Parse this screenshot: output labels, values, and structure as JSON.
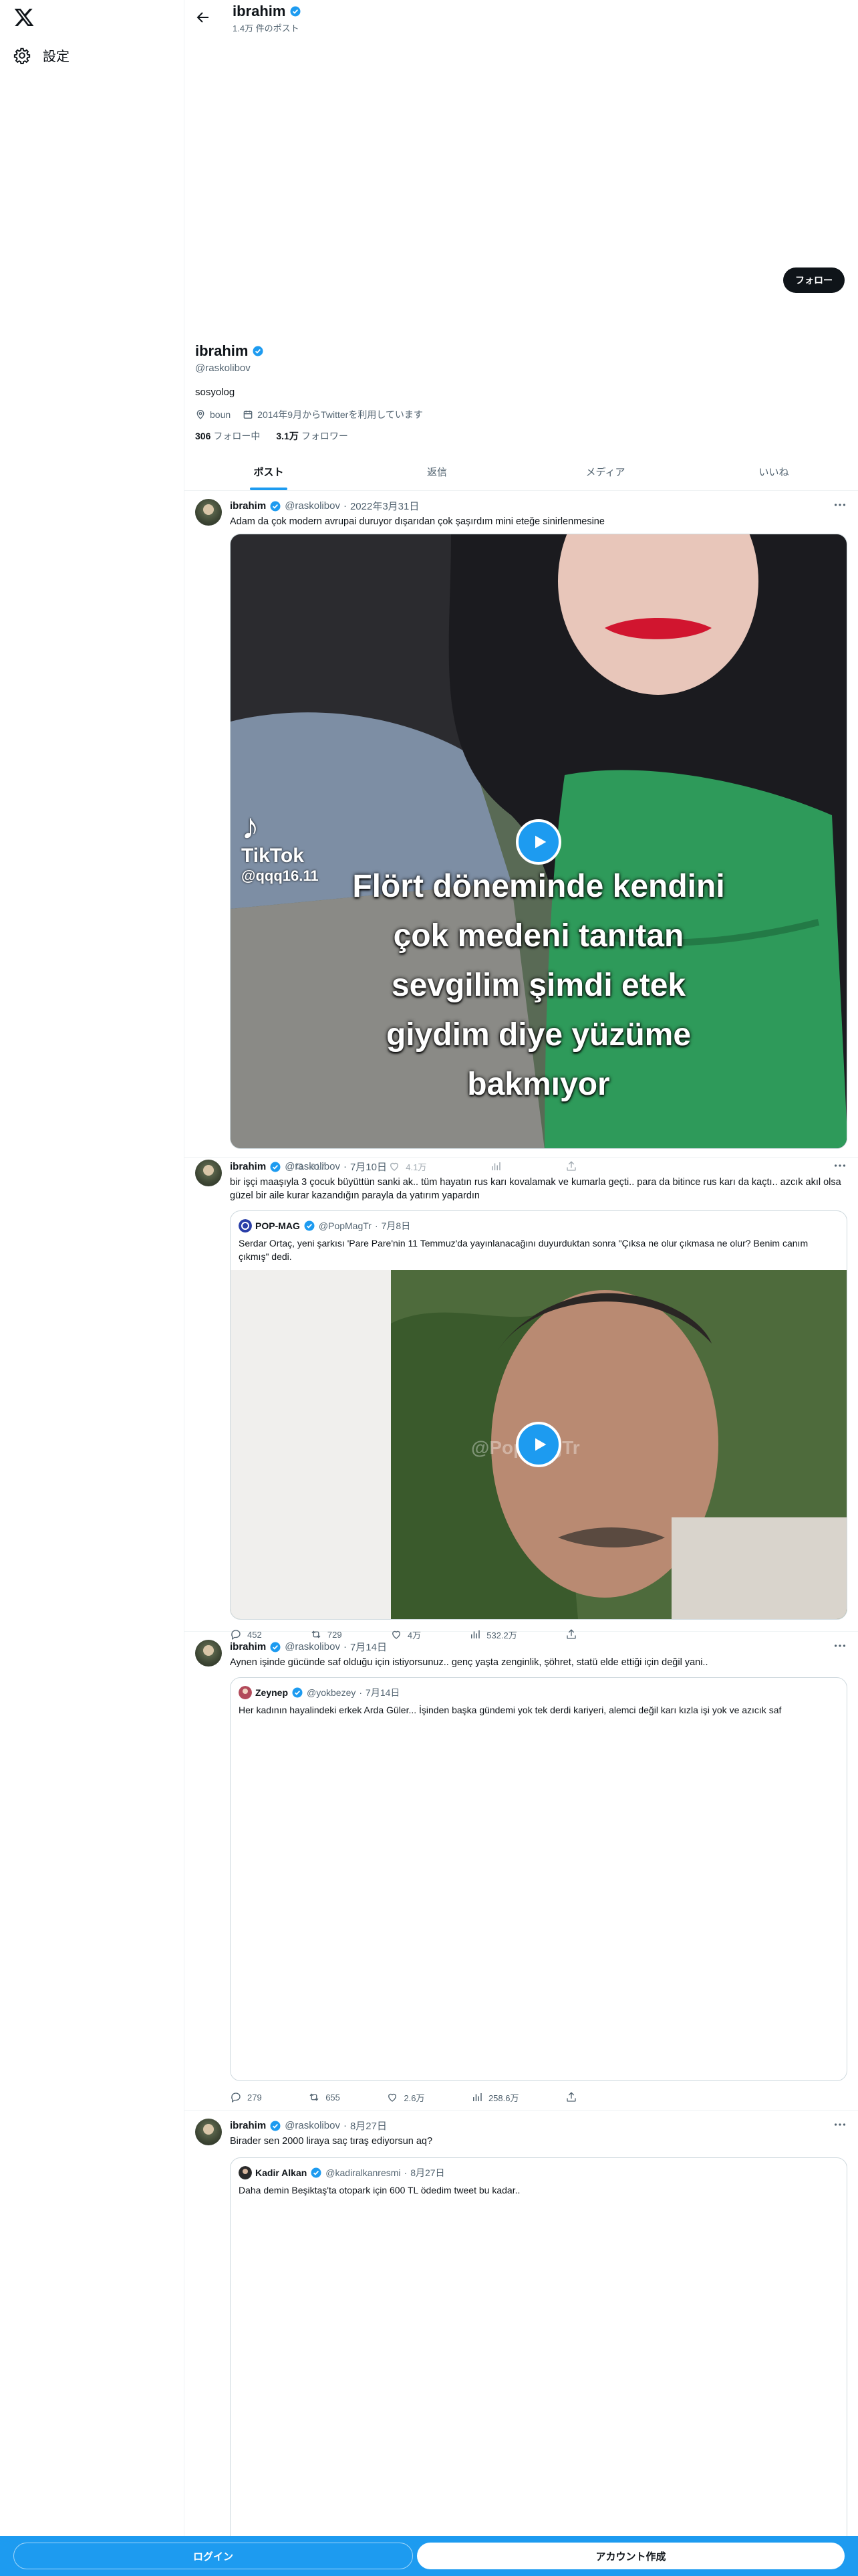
{
  "nav": {
    "settings_label": "設定"
  },
  "header": {
    "name": "ibrahim",
    "post_count": "1.4万 件のポスト"
  },
  "profile": {
    "follow_label": "フォロー",
    "name": "ibrahim",
    "handle": "@raskolibov",
    "bio": "sosyolog",
    "location": "boun",
    "joined": "2014年9月からTwitterを利用しています",
    "following_count": "306",
    "following_label": "フォロー中",
    "followers_count": "3.1万",
    "followers_label": "フォロワー"
  },
  "tabs": [
    {
      "label": "ポスト"
    },
    {
      "label": "返信"
    },
    {
      "label": "メディア"
    },
    {
      "label": "いいね"
    }
  ],
  "tweets": [
    {
      "name": "ibrahim",
      "handle": "@raskolibov",
      "date": "2022年3月31日",
      "text": "Adam da çok modern avrupai duruyor dışarıdan çok şaşırdım mini eteğe sinirlenmesine",
      "video": {
        "watermark_brand": "TikTok",
        "watermark_user": "@qqq16.11",
        "overlay_lines": [
          "Flört döneminde kendini",
          "çok medeni tanıtan",
          "sevgilim şimdi etek",
          "giydim diye yüzüme",
          "bakmıyor"
        ]
      }
    },
    {
      "name": "ibrahim",
      "handle": "@raskolibov",
      "date": "7月10日",
      "text": "bir işçi maaşıyla 3 çocuk büyüttün sanki ak.. tüm hayatın rus karı kovalamak ve kumarla geçti.. para da bitince rus karı da kaçtı.. azcık akıl olsa güzel bir aile kurar kazandığın parayla da yatırım yapardın",
      "quote": {
        "name": "POP-MAG",
        "handle": "@PopMagTr",
        "date": "7月8日",
        "text": "Serdar Ortaç, yeni şarkısı 'Pare Pare'nin 11 Temmuz'da yayınlanacağını duyurduktan sonra \"Çıksa ne olur çıkmasa ne olur? Benim canım çıkmış\" dedi.",
        "watermark": "@PopMagTr"
      },
      "stats": {
        "replies": "452",
        "reposts": "729",
        "likes": "4万",
        "views": "532.2万"
      },
      "overlap_stats": {
        "reposts": "317",
        "likes": "4.1万"
      }
    },
    {
      "name": "ibrahim",
      "handle": "@raskolibov",
      "date": "7月14日",
      "text": "Aynen işinde gücünde saf olduğu için istiyorsunuz.. genç yaşta zenginlik, şöhret, statü elde ettiği için değil yani..",
      "quote": {
        "name": "Zeynep",
        "handle": "@yokbezey",
        "date": "7月14日",
        "text": "Her kadının hayalindeki erkek Arda Güler... İşinden başka gündemi yok tek derdi kariyeri, alemci değil karı kızla işi yok ve azıcık saf"
      },
      "stats": {
        "replies": "279",
        "reposts": "655",
        "likes": "2.6万",
        "views": "258.6万"
      }
    },
    {
      "name": "ibrahim",
      "handle": "@raskolibov",
      "date": "8月27日",
      "text": "Birader sen 2000 liraya saç tıraş ediyorsun aq?",
      "quote": {
        "name": "Kadir Alkan",
        "handle": "@kadiralkanresmi",
        "date": "8月27日",
        "text": "Daha demin Beşiktaş'ta otopark için 600 TL ödedim tweet bu kadar.."
      }
    }
  ],
  "bottom": {
    "login_label": "ログイン",
    "signup_label": "アカウント作成"
  },
  "colors": {
    "accent": "#1d9bf0",
    "text": "#0f1419",
    "muted": "#536471",
    "border": "#eff3f4"
  }
}
